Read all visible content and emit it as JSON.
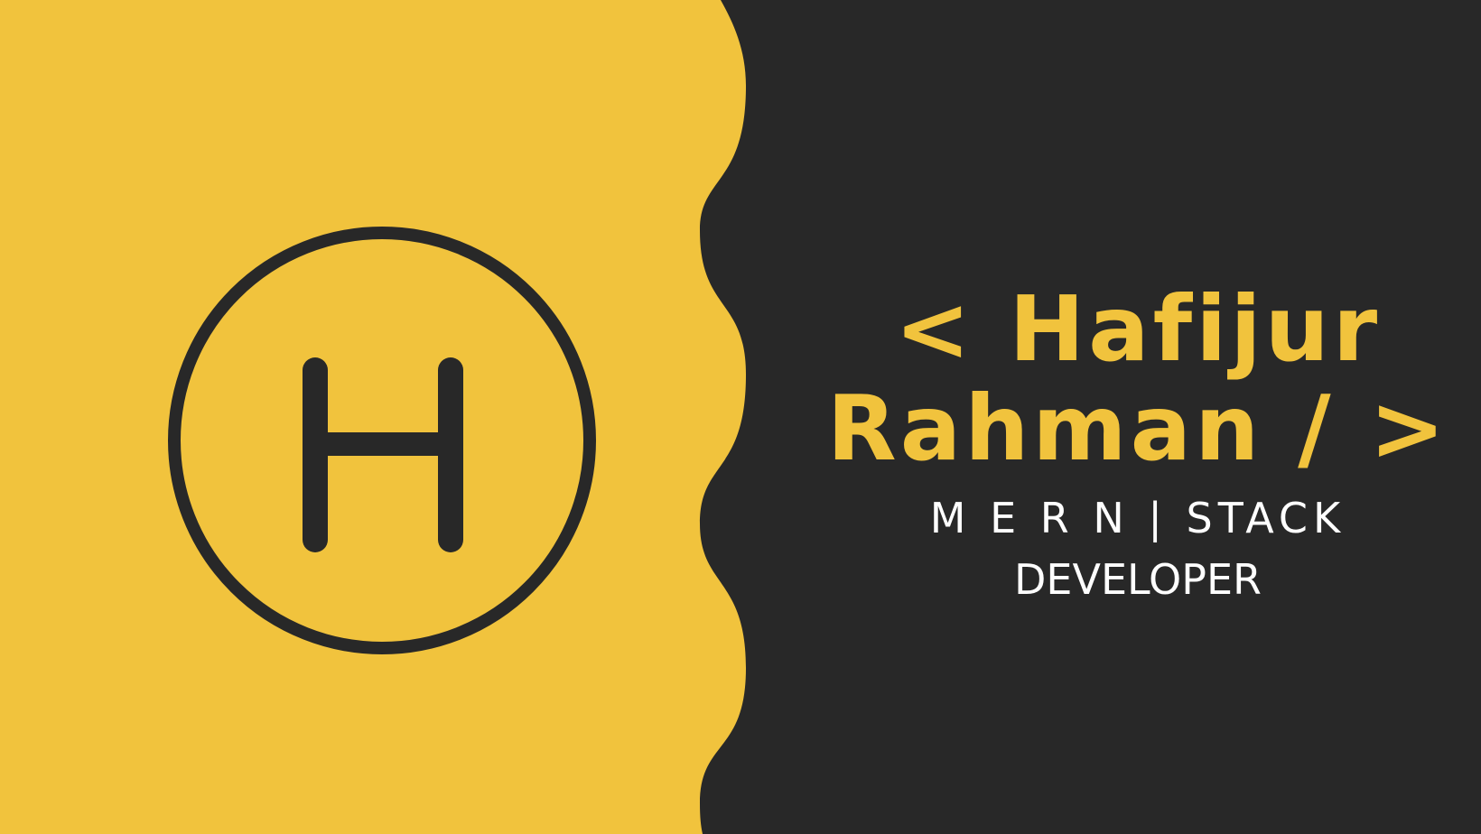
{
  "colors": {
    "yellow": "#F1C33D",
    "dark": "#282828",
    "white": "#FFFFFF"
  },
  "logo": {
    "letter": "H",
    "icon": "monogram-circle-icon"
  },
  "name": {
    "line1": "< Hafijur",
    "line2": "Rahman / >"
  },
  "role": {
    "line1": "M E R N | STACK",
    "line2": "DEVELOPER"
  }
}
